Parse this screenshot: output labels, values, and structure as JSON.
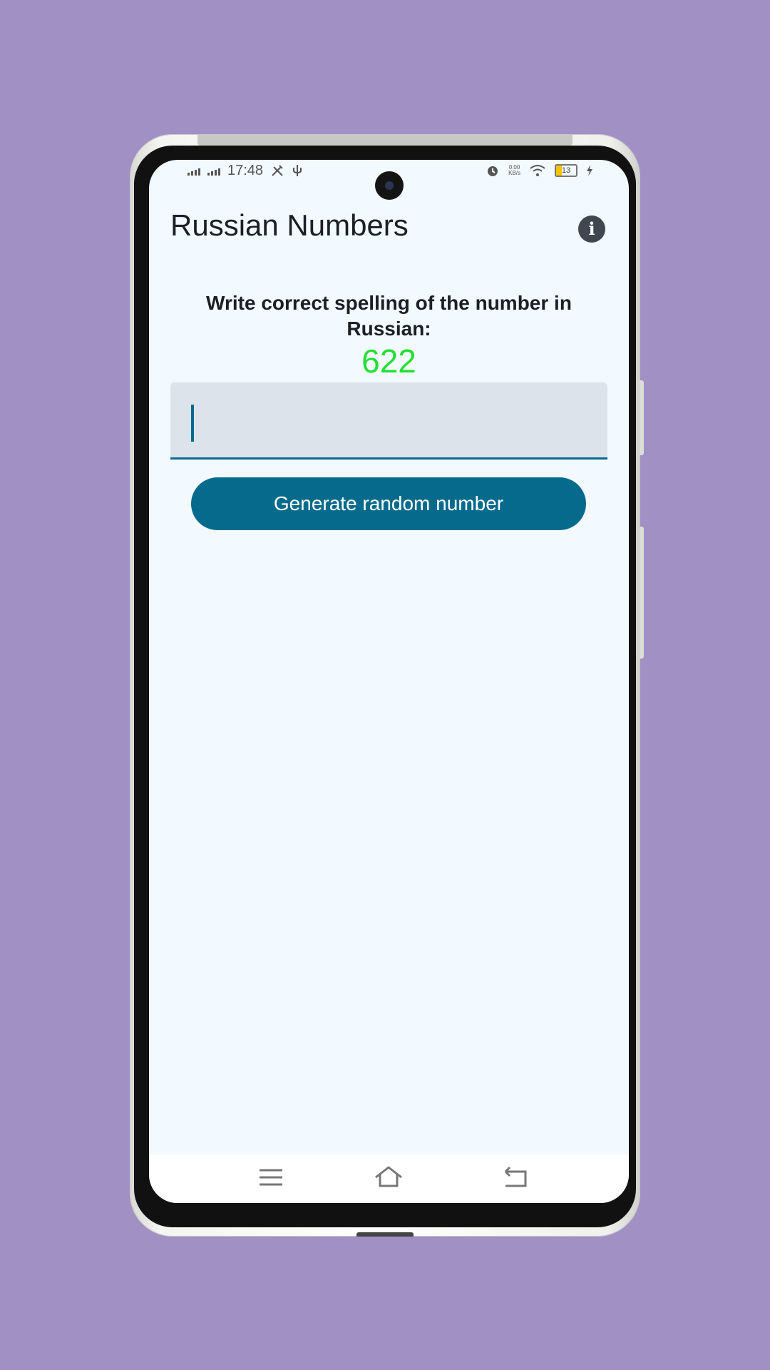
{
  "status_bar": {
    "time": "17:48",
    "net_speed_value": "0.00",
    "net_speed_unit": "KB/s",
    "battery": "13"
  },
  "app": {
    "title": "Russian Numbers"
  },
  "exercise": {
    "prompt": "Write correct spelling of the number in Russian:",
    "number": "622"
  },
  "answer_input": {
    "value": "",
    "placeholder": ""
  },
  "generate_button_label": "Generate random number",
  "colors": {
    "background": "#a190c4",
    "screen": "#f2f9ff",
    "accent": "#066a8c",
    "number": "#22e032",
    "input_fill": "#dde3ea"
  },
  "icons": {
    "info": "info-icon",
    "menu": "menu-icon",
    "home": "home-icon",
    "back": "back-icon"
  }
}
